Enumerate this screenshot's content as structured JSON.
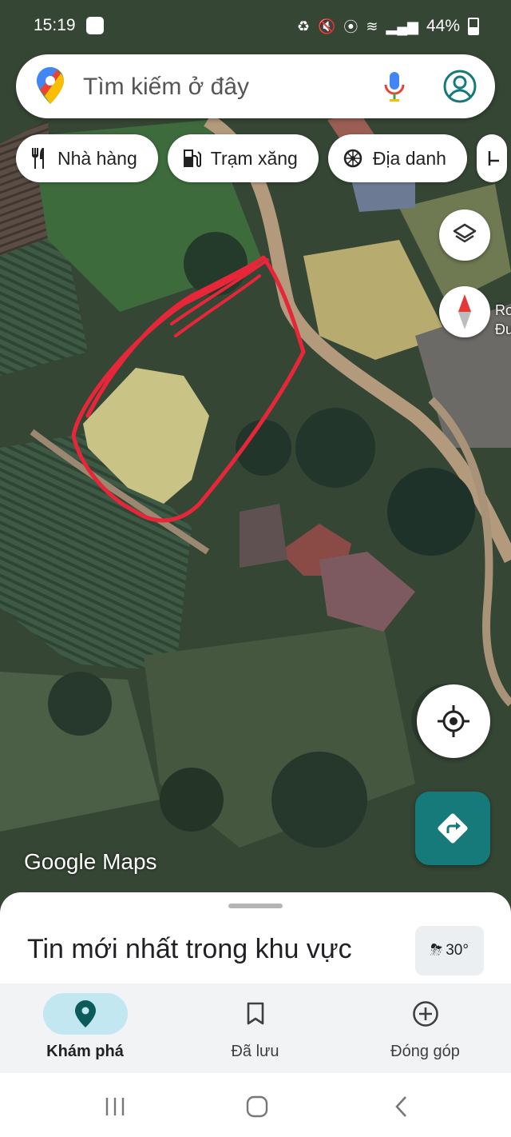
{
  "status_bar": {
    "time": "15:19",
    "battery": "44%"
  },
  "search": {
    "placeholder": "Tìm kiếm ở đây"
  },
  "chips": [
    {
      "label": "Nhà hàng",
      "icon": "restaurant-icon"
    },
    {
      "label": "Trạm xăng",
      "icon": "gas-station-icon"
    },
    {
      "label": "Địa danh",
      "icon": "landmark-icon"
    }
  ],
  "map": {
    "place_label_line1": "Ro",
    "place_label_line2": "Đư",
    "logo": "Google Maps"
  },
  "sheet": {
    "title": "Tin mới nhất trong khu vực",
    "weather_temp": "30°"
  },
  "bottom_nav": [
    {
      "label": "Khám phá",
      "icon": "explore-pin-icon",
      "active": true
    },
    {
      "label": "Đã lưu",
      "icon": "bookmark-icon",
      "active": false
    },
    {
      "label": "Đóng góp",
      "icon": "add-circle-icon",
      "active": false
    }
  ],
  "colors": {
    "accent": "#177a7a",
    "annotation": "#e8263a",
    "nav_active": "#c2e7f0"
  }
}
